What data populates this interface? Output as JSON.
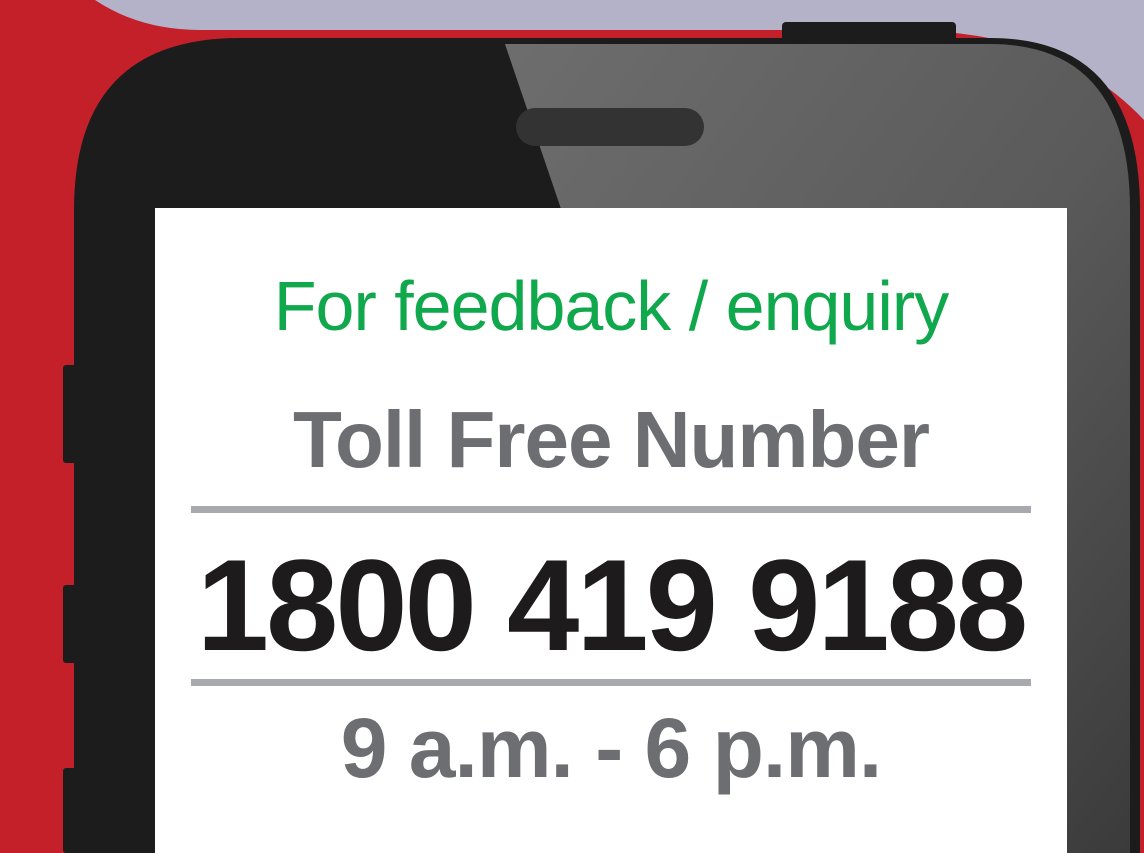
{
  "colors": {
    "background_red": "#c3202a",
    "background_lavender": "#b3b2c8",
    "phone_body": "#1c1c1c",
    "phone_glare": "#6b6b6b",
    "screen": "#ffffff",
    "accent_green": "#10a84c",
    "text_gray": "#6d6e71",
    "text_black": "#1d1b1c",
    "divider_gray": "#a7a9ac"
  },
  "screen": {
    "subtitle": "For feedback / enquiry",
    "heading": "Toll Free Number",
    "phone_number": "1800 419 9188",
    "hours": "9 a.m. - 6 p.m."
  }
}
